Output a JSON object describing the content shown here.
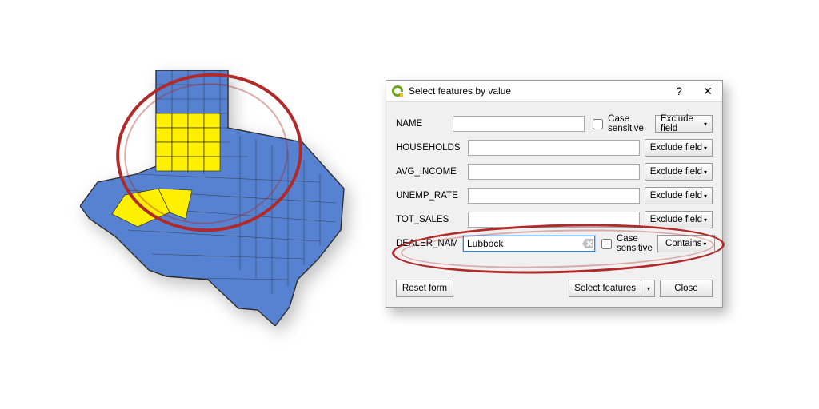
{
  "dialog": {
    "title": "Select features by value",
    "help_symbol": "?",
    "close_symbol": "✕",
    "fields": [
      {
        "label": "NAME",
        "value": "",
        "has_case": true,
        "button": "Exclude field",
        "active": false
      },
      {
        "label": "HOUSEHOLDS",
        "value": "",
        "has_case": false,
        "button": "Exclude field",
        "active": false
      },
      {
        "label": "AVG_INCOME",
        "value": "",
        "has_case": false,
        "button": "Exclude field",
        "active": false
      },
      {
        "label": "UNEMP_RATE",
        "value": "",
        "has_case": false,
        "button": "Exclude field",
        "active": false
      },
      {
        "label": "TOT_SALES",
        "value": "",
        "has_case": false,
        "button": "Exclude field",
        "active": false
      },
      {
        "label": "DEALER_NAM",
        "value": "Lubbock",
        "has_case": true,
        "button": "Contains",
        "active": true
      }
    ],
    "case_sensitive_label": "Case sensitive",
    "reset_label": "Reset form",
    "select_label": "Select features",
    "close_label": "Close",
    "caret": "▾"
  },
  "map": {
    "state": "Texas",
    "base_color": "#5682d1",
    "highlight_color": "#fff000",
    "outline_color": "#2d2d2d",
    "highlighted_region": "Lubbock dealer counties (panhandle + west-central)"
  }
}
